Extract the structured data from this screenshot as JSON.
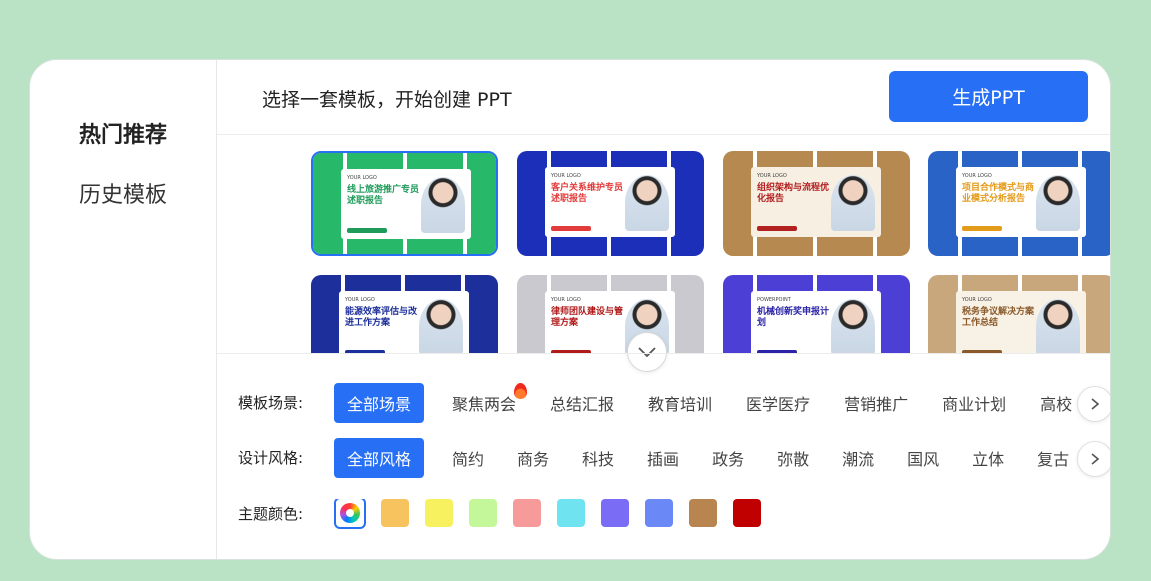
{
  "sidebar": {
    "items": [
      {
        "label": "热门推荐",
        "active": true
      },
      {
        "label": "历史模板",
        "active": false
      }
    ]
  },
  "header": {
    "hint": "选择一套模板，开始创建 PPT",
    "generate_label": "生成PPT"
  },
  "gallery": {
    "thumbnails": [
      {
        "title": "线上旅游推广专员述职报告",
        "logo": "YOUR LOGO",
        "bg": "#27b86a",
        "card": "#ffffff",
        "accent": "#1f9b5a",
        "selected": true
      },
      {
        "title": "客户关系维护专员述职报告",
        "logo": "YOUR LOGO",
        "bg": "#1c2fb8",
        "card": "#ffffff",
        "accent": "#e23b3b",
        "selected": false
      },
      {
        "title": "组织架构与流程优化报告",
        "logo": "YOUR LOGO",
        "bg": "#b5894f",
        "card": "#f6efe2",
        "accent": "#b32020",
        "selected": false
      },
      {
        "title": "项目合作模式与商业模式分析报告",
        "logo": "YOUR LOGO",
        "bg": "#2a63c6",
        "card": "#ffffff",
        "accent": "#e39b1a",
        "selected": false
      },
      {
        "title": "能源效率评估与改进工作方案",
        "logo": "YOUR LOGO",
        "bg": "#1d2f9a",
        "card": "#ffffff",
        "accent": "#1d2f9a",
        "selected": false
      },
      {
        "title": "律师团队建设与管理方案",
        "logo": "YOUR LOGO",
        "bg": "#c9c9cf",
        "card": "#ffffff",
        "accent": "#b01a1a",
        "selected": false
      },
      {
        "title": "机械创新奖申报计划",
        "logo": "POWERPOINT",
        "bg": "#4b3fd6",
        "card": "#ffffff",
        "accent": "#2b24a8",
        "selected": false
      },
      {
        "title": "税务争议解决方案工作总结",
        "logo": "YOUR LOGO",
        "bg": "#c9a77c",
        "card": "#f8f1e6",
        "accent": "#8a5a2a",
        "selected": false
      }
    ],
    "expand_icon": "chevron-down-icon"
  },
  "filters": {
    "scene": {
      "label": "模板场景:",
      "items": [
        "全部场景",
        "聚焦两会",
        "总结汇报",
        "教育培训",
        "医学医疗",
        "营销推广",
        "商业计划",
        "高校"
      ],
      "active": 0,
      "hot_item": 1
    },
    "style": {
      "label": "设计风格:",
      "items": [
        "全部风格",
        "简约",
        "商务",
        "科技",
        "插画",
        "政务",
        "弥散",
        "潮流",
        "国风",
        "立体",
        "复古"
      ],
      "active": 0
    },
    "color": {
      "label": "主题颜色:",
      "swatches": [
        "#f7c35f",
        "#f8f15f",
        "#c4f79a",
        "#f79a9a",
        "#6fe3f0",
        "#7b6cf6",
        "#6b88f7",
        "#b8844f",
        "#c00000"
      ]
    }
  }
}
